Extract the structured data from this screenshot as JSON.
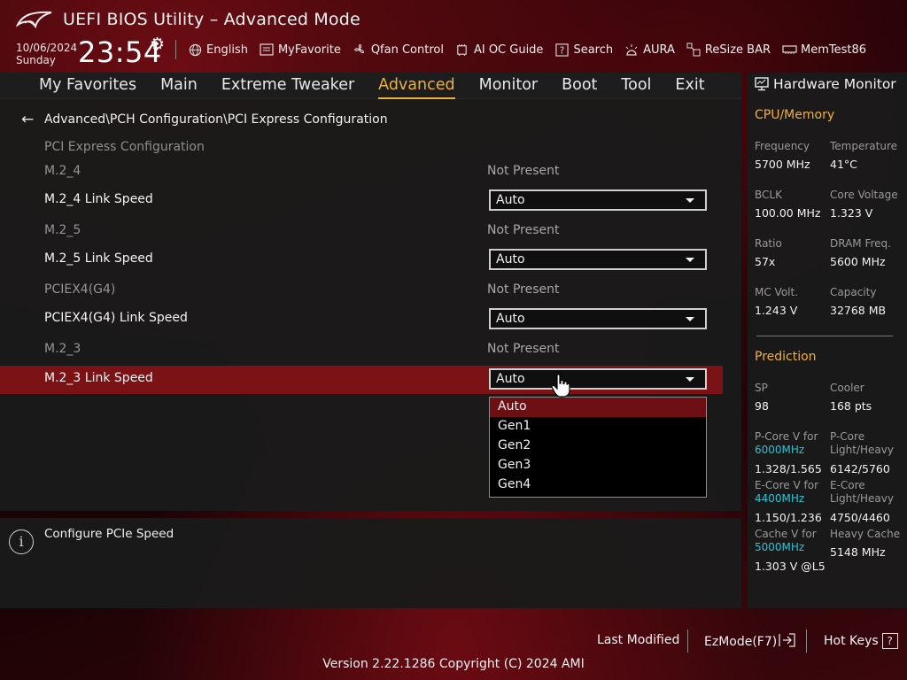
{
  "header": {
    "title": "UEFI BIOS Utility – Advanced Mode",
    "date": "10/06/2024",
    "day": "Sunday",
    "time": "23:54",
    "toolbar": [
      {
        "label": "English",
        "icon": "globe-icon"
      },
      {
        "label": "MyFavorite",
        "icon": "favorite-icon"
      },
      {
        "label": "Qfan Control",
        "icon": "fan-icon"
      },
      {
        "label": "AI OC Guide",
        "icon": "ai-chip-icon"
      },
      {
        "label": "Search",
        "icon": "question-box-icon"
      },
      {
        "label": "AURA",
        "icon": "aura-light-icon"
      },
      {
        "label": "ReSize BAR",
        "icon": "resize-bar-icon"
      },
      {
        "label": "MemTest86",
        "icon": "memory-icon"
      }
    ]
  },
  "menu": [
    {
      "label": "My Favorites",
      "active": false
    },
    {
      "label": "Main",
      "active": false
    },
    {
      "label": "Extreme Tweaker",
      "active": false
    },
    {
      "label": "Advanced",
      "active": true
    },
    {
      "label": "Monitor",
      "active": false
    },
    {
      "label": "Boot",
      "active": false
    },
    {
      "label": "Tool",
      "active": false
    },
    {
      "label": "Exit",
      "active": false
    }
  ],
  "breadcrumb": "Advanced\\PCH Configuration\\PCI Express Configuration",
  "section_title": "PCI Express Configuration",
  "rows": [
    {
      "label": "M.2_4",
      "value": "Not Present"
    },
    {
      "label": "M.2_4 Link Speed",
      "dropdown": "Auto"
    },
    {
      "label": "M.2_5",
      "value": "Not Present"
    },
    {
      "label": "M.2_5 Link Speed",
      "dropdown": "Auto"
    },
    {
      "label": "PCIEX4(G4)",
      "value": "Not Present"
    },
    {
      "label": "PCIEX4(G4) Link Speed",
      "dropdown": "Auto"
    },
    {
      "label": "M.2_3",
      "value": "Not Present"
    },
    {
      "label": "M.2_3 Link Speed",
      "dropdown": "Auto",
      "highlighted": true
    }
  ],
  "dropdown_options": [
    "Auto",
    "Gen1",
    "Gen2",
    "Gen3",
    "Gen4"
  ],
  "dropdown_selected": "Auto",
  "help_text": "Configure PCIe Speed",
  "hardware_monitor": {
    "title": "Hardware Monitor",
    "cpu_memory": {
      "heading": "CPU/Memory",
      "items": [
        {
          "label": "Frequency",
          "value": "5700 MHz"
        },
        {
          "label": "Temperature",
          "value": "41°C"
        },
        {
          "label": "BCLK",
          "value": "100.00 MHz"
        },
        {
          "label": "Core Voltage",
          "value": "1.323 V"
        },
        {
          "label": "Ratio",
          "value": "57x"
        },
        {
          "label": "DRAM Freq.",
          "value": "5600 MHz"
        },
        {
          "label": "MC Volt.",
          "value": "1.243 V"
        },
        {
          "label": "Capacity",
          "value": "32768 MB"
        }
      ]
    },
    "prediction": {
      "heading": "Prediction",
      "sp_label": "SP",
      "sp_value": "98",
      "cooler_label": "Cooler",
      "cooler_value": "168 pts",
      "pcore_v_label": "P-Core V for",
      "pcore_v_freq": "6000MHz",
      "pcore_v_value": "1.328/1.565",
      "pcore_lh_label1": "P-Core",
      "pcore_lh_label2": "Light/Heavy",
      "pcore_lh_value": "6142/5760",
      "ecore_v_label": "E-Core V for",
      "ecore_v_freq": "4400MHz",
      "ecore_v_value": "1.150/1.236",
      "ecore_lh_label1": "E-Core",
      "ecore_lh_label2": "Light/Heavy",
      "ecore_lh_value": "4750/4460",
      "cache_v_label": "Cache V for",
      "cache_v_freq": "5000MHz",
      "cache_v_value": "1.303 V @L5",
      "heavy_cache_label": "Heavy Cache",
      "heavy_cache_value": "5148 MHz"
    }
  },
  "footer": {
    "last_modified": "Last Modified",
    "ezmode": "EzMode(F7)",
    "hotkeys": "Hot Keys",
    "hotkeys_icon": "?",
    "version": "Version 2.22.1286 Copyright (C) 2024 AMI"
  },
  "colors": {
    "accent": "#f0b13a",
    "highlight_row": "#7a1216",
    "freq_cyan": "#29c3d4"
  }
}
